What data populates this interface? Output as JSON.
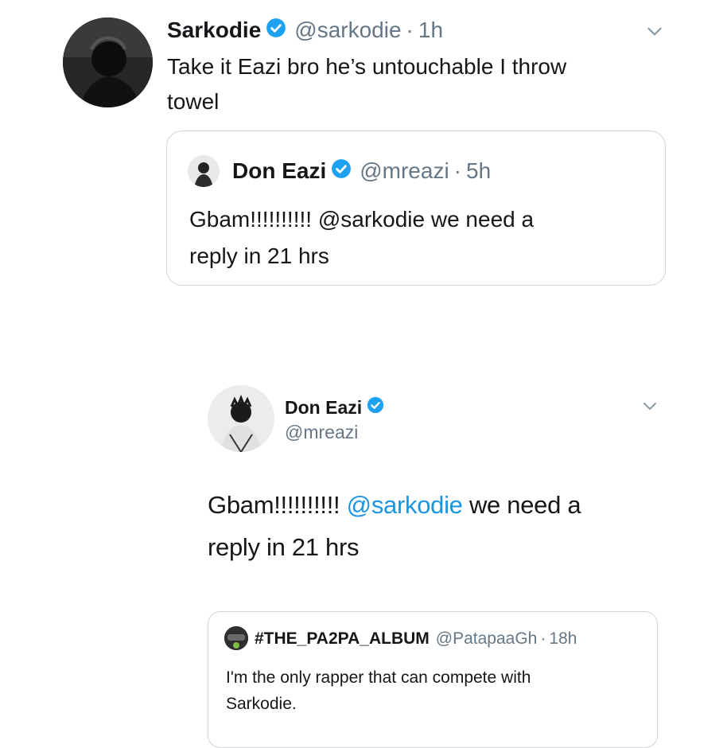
{
  "tweet1": {
    "name": "Sarkodie",
    "handle": "@sarkodie",
    "dot": "·",
    "time": "1h",
    "text_line1": "Take it Eazi bro he’s untouchable I throw",
    "text_line2": "towel",
    "quote": {
      "name": "Don Eazi",
      "handle": "@mreazi",
      "dot": "·",
      "time": "5h",
      "text_line1": "Gbam!!!!!!!!!! @sarkodie we need a",
      "text_line2": "reply in 21 hrs"
    }
  },
  "tweet2": {
    "name": "Don Eazi",
    "handle": "@mreazi",
    "text_pre": "Gbam!!!!!!!!!! ",
    "mention": "@sarkodie",
    "text_post": " we need a",
    "text_line2": "reply in 21 hrs",
    "quote": {
      "name": "#THE_PA2PA_ALBUM",
      "handle": "@PatapaaGh",
      "dot": "·",
      "time": "18h",
      "text_line1": "I'm the only rapper that can compete with",
      "text_line2": "Sarkodie."
    }
  },
  "icons": {
    "verified": "verified-badge-icon",
    "caret": "chevron-down-icon"
  },
  "colors": {
    "verified_blue": "#1da1f2",
    "link_blue": "#1b95e0",
    "muted": "#657786",
    "border": "#ccd6dd"
  }
}
